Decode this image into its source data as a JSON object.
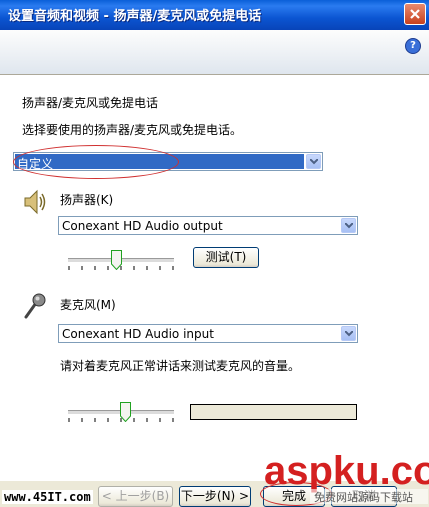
{
  "window": {
    "title": "设置音频和视频 - 扬声器/麦克风或免提电话"
  },
  "page": {
    "heading": "扬声器/麦克风或免提电话",
    "instruction": "选择要使用的扬声器/麦克风或免提电话。",
    "preset": {
      "value": "自定义"
    },
    "speaker": {
      "label": "扬声器(K)",
      "device": "Conexant HD Audio output",
      "test_button": "测试(T)",
      "volume_level": 0.45
    },
    "microphone": {
      "label": "麦克风(M)",
      "device": "Conexant HD Audio input",
      "hint": "请对着麦克风正常讲话来测试麦克风的音量。",
      "volume_level": 0.55,
      "input_level": 0
    }
  },
  "footer": {
    "back": "< 上一步(B)",
    "next": "下一步(N) >",
    "finish": "完成",
    "cancel": "取消"
  },
  "watermarks": {
    "left": "www.45IT.com",
    "right_logo": "aspku.com",
    "right_caption": "免费网站源码下载站"
  },
  "colors": {
    "titlebar": "#0b55d2",
    "selection": "#316ac5",
    "annotation_ellipse": "#d03030"
  },
  "icons": [
    "close-icon",
    "help-icon",
    "speaker-icon",
    "microphone-icon",
    "chevron-down-icon"
  ]
}
